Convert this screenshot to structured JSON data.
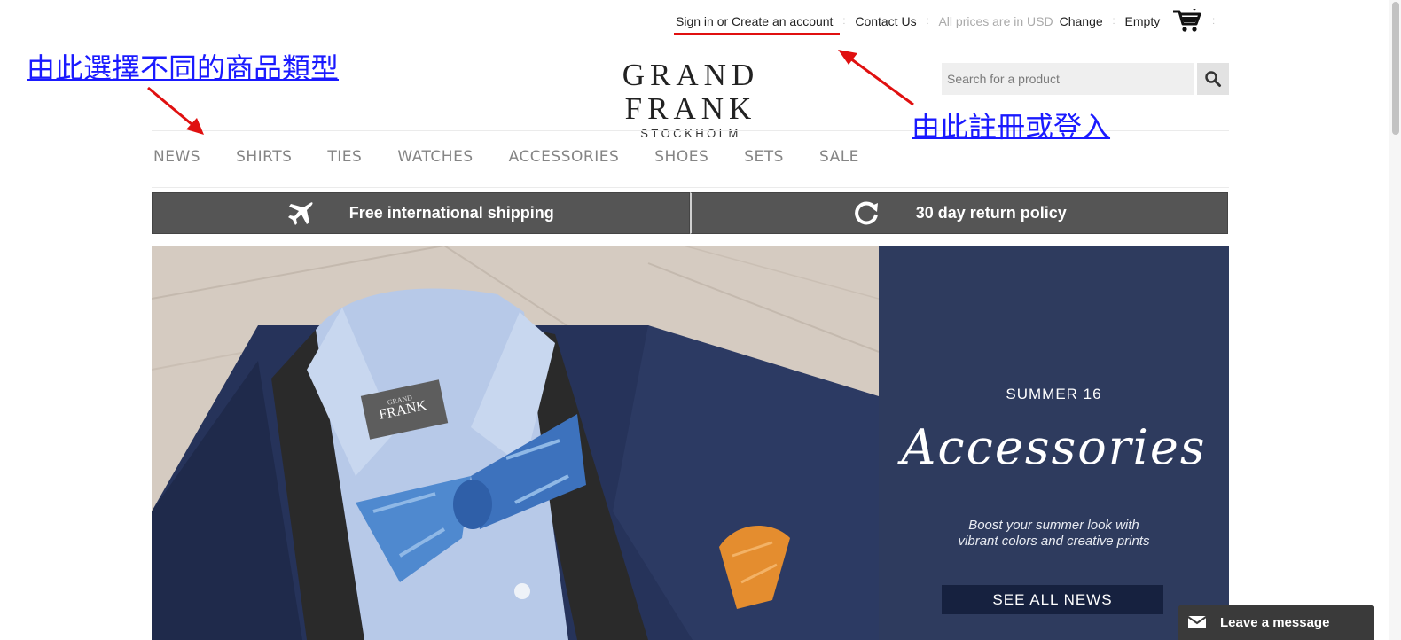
{
  "topbar": {
    "signin": "Sign in or Create an account",
    "contact": "Contact Us",
    "prices": "All prices are in USD",
    "change": "Change",
    "cart": "Empty"
  },
  "logo": {
    "name": "GRAND FRANK",
    "city": "STOCKHOLM"
  },
  "search": {
    "placeholder": "Search for a product"
  },
  "nav": {
    "items": [
      "NEWS",
      "SHIRTS",
      "TIES",
      "WATCHES",
      "ACCESSORIES",
      "SHOES",
      "SETS",
      "SALE"
    ]
  },
  "promo": {
    "shipping": "Free international shipping",
    "returns": "30 day return policy"
  },
  "hero": {
    "season": "SUMMER 16",
    "script": "Accessories",
    "tagline_line1": "Boost your summer look with",
    "tagline_line2": "vibrant colors and creative prints",
    "cta": "SEE ALL NEWS",
    "label_brand_small": "GRAND",
    "label_brand": "FRANK"
  },
  "annotations": {
    "left": "由此選擇不同的商品類型",
    "right": "由此註冊或登入"
  },
  "chat": {
    "label": "Leave a message"
  },
  "colors": {
    "panel": "#2e3b5e",
    "cta": "#16213f",
    "promo": "#555555",
    "annotation": "#1a1aff",
    "arrow": "#e01010"
  }
}
